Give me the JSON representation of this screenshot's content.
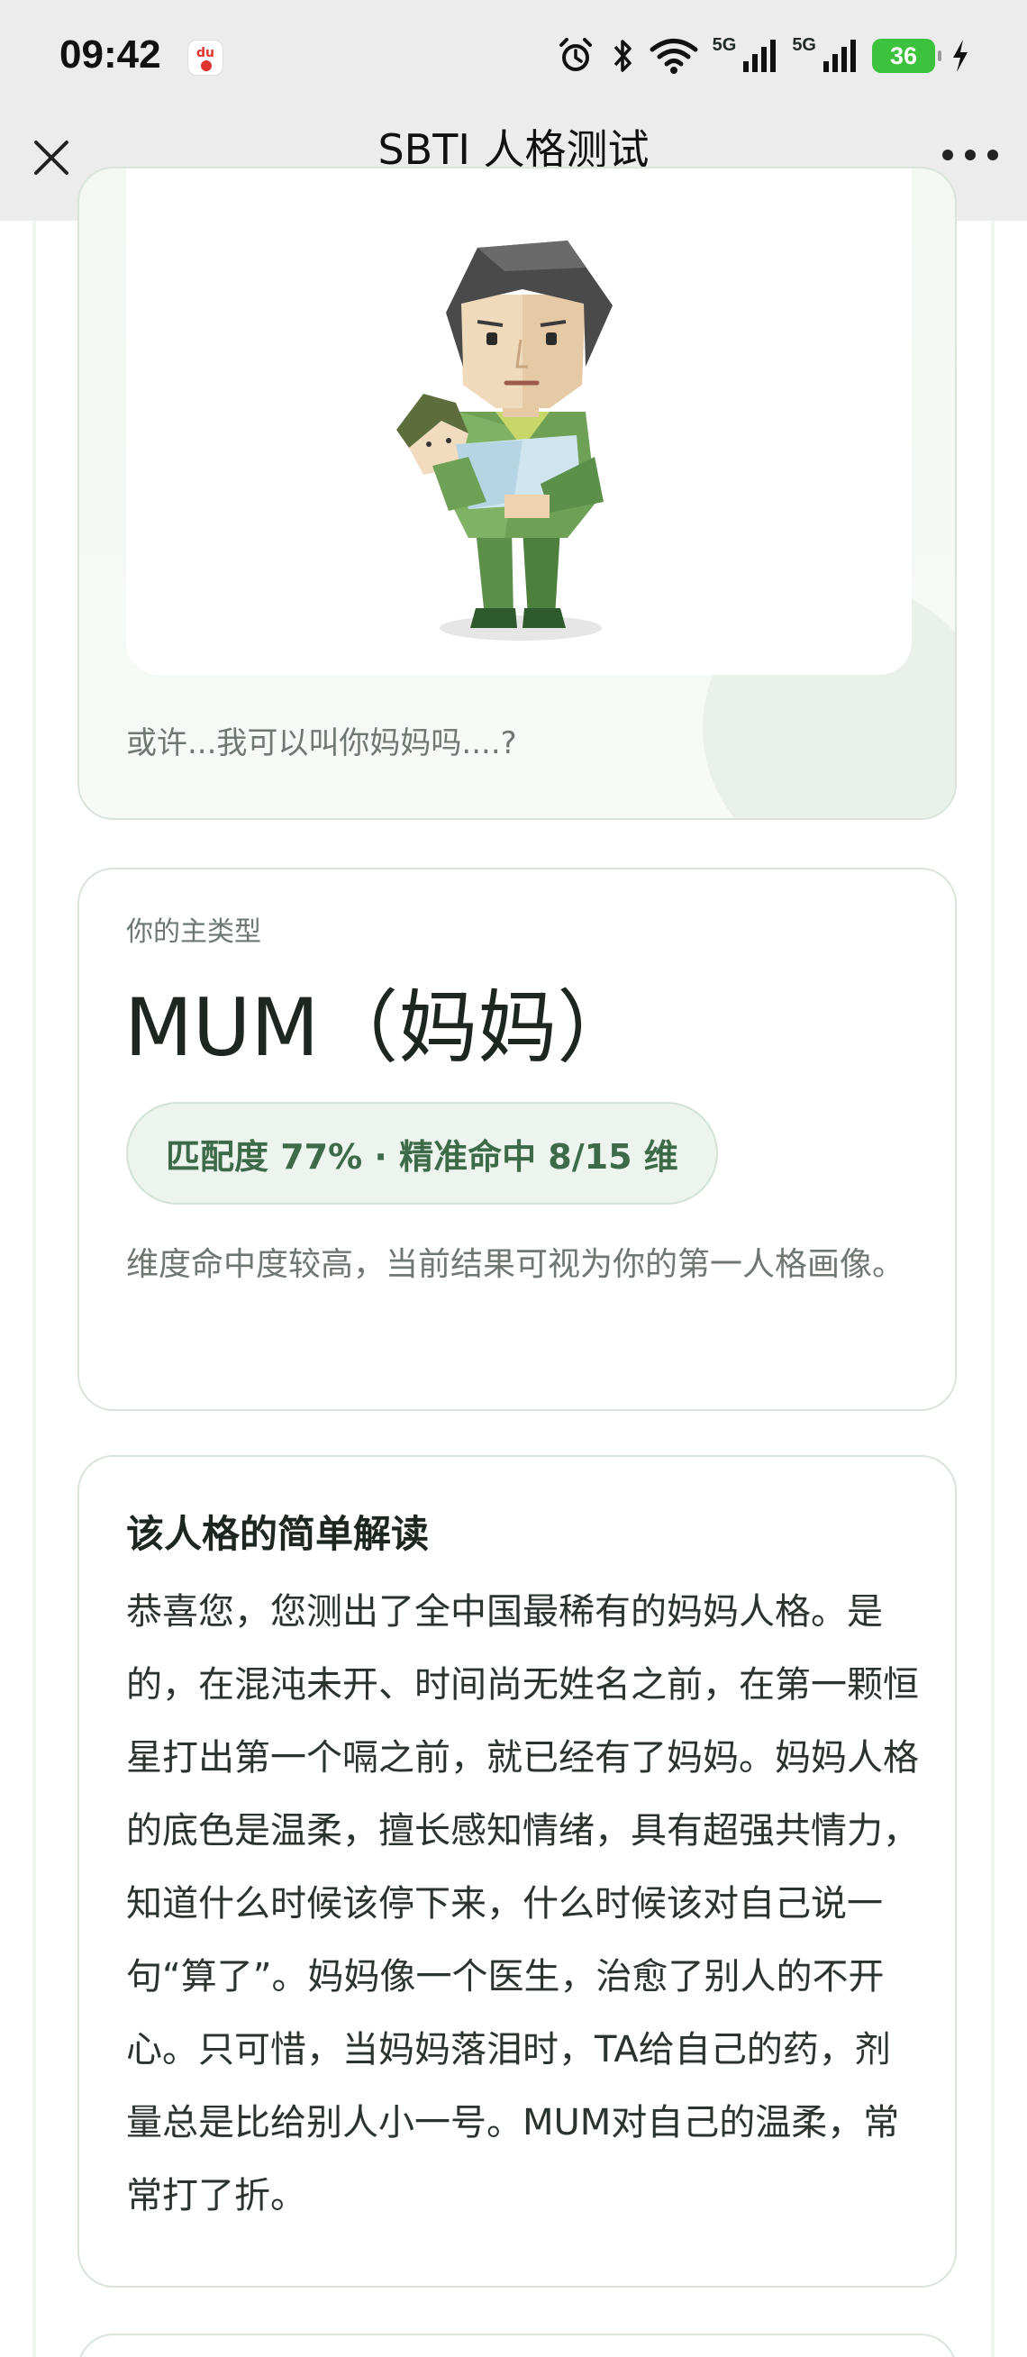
{
  "status_bar": {
    "time": "09:42",
    "battery": "36",
    "network1": "5G",
    "network2": "5G",
    "icons": [
      "du-app-icon",
      "alarm-icon",
      "bluetooth-icon",
      "wifi-icon",
      "signal-icon",
      "battery-icon",
      "charging-icon"
    ]
  },
  "nav": {
    "title": "SBTI 人格测试"
  },
  "hero": {
    "caption": "或许...我可以叫你妈妈吗....?"
  },
  "type_card": {
    "label": "你的主类型",
    "name": "MUM（妈妈）",
    "match": "匹配度 77% · 精准命中 8/15 维",
    "description": "维度命中度较高，当前结果可视为你的第一人格画像。"
  },
  "reading_card": {
    "title": "该人格的简单解读",
    "body": "恭喜您，您测出了全中国最稀有的妈妈人格。是的，在混沌未开、时间尚无姓名之前，在第一颗恒星打出第一个嗝之前，就已经有了妈妈。妈妈人格的底色是温柔，擅长感知情绪，具有超强共情力，知道什么时候该停下来，什么时候该对自己说一句“算了”。妈妈像一个医生，治愈了别人的不开心。只可惜，当妈妈落泪时，TA给自己的药，剂量总是比给别人小一号。MUM对自己的温柔，常常打了折。"
  },
  "colors": {
    "accent_green": "#3d6b4a",
    "pill_bg": "#edf4ee",
    "card_border": "#d8e4da",
    "battery_green": "#3cc23c"
  }
}
